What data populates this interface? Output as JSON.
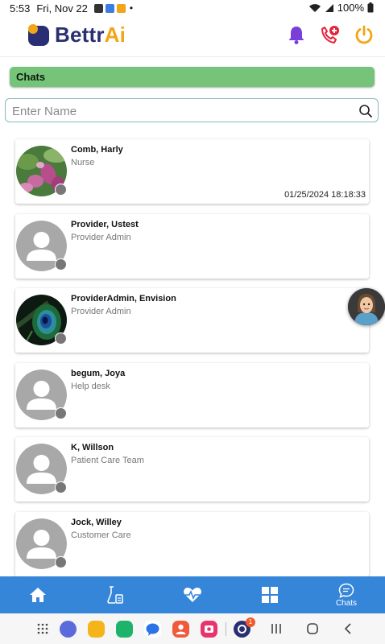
{
  "status_bar": {
    "time": "5:53",
    "date": "Fri, Nov 22",
    "dot": "•",
    "battery": "100%"
  },
  "header": {
    "logo_text_1": "Bettr",
    "logo_text_2": "Ai",
    "icons": [
      "bell-icon",
      "phone-plus-icon",
      "power-icon"
    ],
    "colors": {
      "bell": "#7b3fd9",
      "phone": "#e4233b",
      "power": "#f2a516"
    }
  },
  "section": {
    "title": "Chats"
  },
  "search": {
    "placeholder": "Enter Name",
    "value": ""
  },
  "chats": [
    {
      "name": "Comb, Harly",
      "role": "Nurse",
      "time": "01/25/2024 18:18:33",
      "avatar": "flower-photo"
    },
    {
      "name": "Provider, Ustest",
      "role": "Provider Admin",
      "time": "",
      "avatar": "default-person"
    },
    {
      "name": "ProviderAdmin, Envision",
      "role": "Provider Admin",
      "time": "",
      "avatar": "peacock-feather-photo"
    },
    {
      "name": "begum, Joya",
      "role": "Help desk",
      "time": "",
      "avatar": "default-person"
    },
    {
      "name": "K, Willson",
      "role": "Patient Care Team",
      "time": "",
      "avatar": "default-person"
    },
    {
      "name": "Jock, Willey",
      "role": "Customer Care",
      "time": "",
      "avatar": "default-person"
    }
  ],
  "bottom_nav": {
    "items": [
      {
        "icon": "home-icon",
        "label": ""
      },
      {
        "icon": "lab-icon",
        "label": ""
      },
      {
        "icon": "heartbeat-icon",
        "label": ""
      },
      {
        "icon": "grid-icon",
        "label": ""
      },
      {
        "icon": "chat-icon",
        "label": "Chats"
      }
    ],
    "active": "Chats"
  },
  "system_nav": {
    "dock": [
      "app-drawer-icon",
      "messages-app-icon",
      "files-app-icon",
      "phone-app-icon",
      "chat-app-icon",
      "contacts-app-icon",
      "screen-recorder-icon",
      "bettrai-app-icon"
    ],
    "badge": "1"
  }
}
